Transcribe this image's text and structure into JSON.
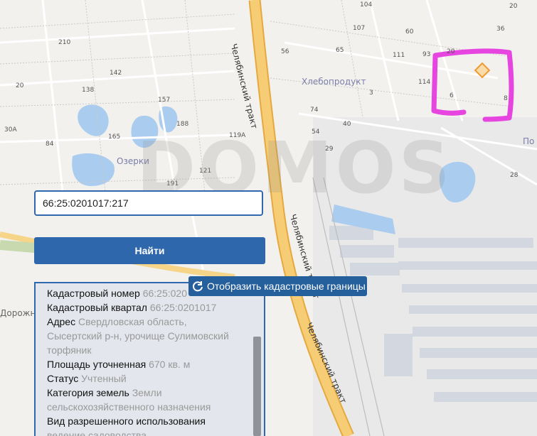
{
  "map": {
    "labels": {
      "n104": "104",
      "n20a": "20",
      "n210": "210",
      "n107": "107",
      "n56": "56",
      "n65": "65",
      "n111": "111",
      "n93": "93",
      "n20b": "20",
      "n142": "142",
      "n138": "138",
      "n114": "114",
      "n6": "6",
      "n157": "157",
      "n8": "8",
      "n30a": "30A",
      "n165": "165",
      "n188": "188",
      "n119a": "119A",
      "n84": "84",
      "n20c": "20",
      "n121": "121",
      "n191": "191",
      "n28": "28",
      "n40": "40",
      "n36": "36",
      "n60": "60",
      "n54": "54",
      "n74": "74",
      "n29": "29",
      "n3": "3"
    },
    "places": {
      "khleboprodukt": "Хлебопродукт",
      "ozerki": "Озерки",
      "po": "По"
    },
    "roads": {
      "chelyab_top": "Челябинский тракт",
      "chelyab_mid": "Челябинский тракт",
      "chelyab_low": "Челябинский тракт",
      "dorozh": "Дорожн"
    },
    "watermark": "DOMOS",
    "colors": {
      "highway": "#f0c060",
      "water": "#aacdef",
      "highlight": "#e645e0",
      "parcel": "#f4a742"
    }
  },
  "search": {
    "value": "66:25:0201017:217"
  },
  "find_button": {
    "label": "Найти"
  },
  "cadastral_button": {
    "label": "Отобразить кадастровые границы"
  },
  "info": {
    "cad_number": {
      "key": "Кадастровый номер",
      "value": "66:25:020"
    },
    "cad_quarter": {
      "key": "Кадастровый квартал",
      "value": "66:25:0201017"
    },
    "address": {
      "key": "Адрес",
      "value1": "Свердловская область,",
      "value2": "Сысертский р-н, урочище Сулимовский",
      "value3": "торфяник"
    },
    "area": {
      "key": "Площадь уточненная",
      "value": "670 кв. м"
    },
    "status": {
      "key": "Статус",
      "value": "Учтенный"
    },
    "category": {
      "key": "Категория земель",
      "value1": "Земли",
      "value2": "сельскохозяйственного назначения"
    },
    "usage": {
      "key": "Вид разрешенного использования",
      "value": "ведение садоводства"
    }
  }
}
